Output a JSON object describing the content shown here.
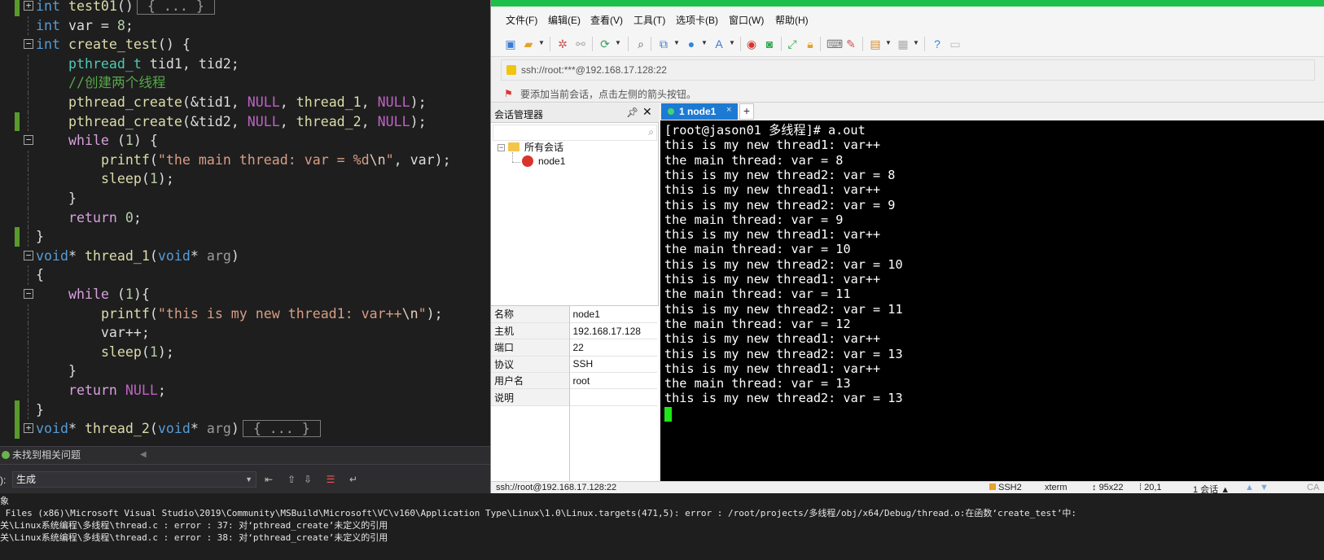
{
  "editor": {
    "lines": [
      {
        "tokens": [
          [
            "kw",
            "int "
          ],
          [
            "fn",
            "test01"
          ],
          [
            "",
            "()"
          ]
        ],
        "collapsed": "{ ... }",
        "fold": "+",
        "mark": true
      },
      {
        "tokens": [
          [
            "kw",
            "int "
          ],
          [
            "",
            "var = "
          ],
          [
            "num",
            "8"
          ],
          [
            "",
            ";"
          ]
        ],
        "fold": "",
        "mark": false
      },
      {
        "tokens": [
          [
            "kw",
            "int "
          ],
          [
            "fn",
            "create_test"
          ],
          [
            "",
            "() {"
          ]
        ],
        "fold": "-",
        "mark": false
      },
      {
        "tokens": [
          [
            "",
            "    "
          ],
          [
            "ty",
            "pthread_t"
          ],
          [
            "",
            " tid1, tid2;"
          ]
        ],
        "fold": "",
        "mark": false
      },
      {
        "tokens": [
          [
            "",
            "    "
          ],
          [
            "cm",
            "//创建两个线程"
          ]
        ],
        "fold": "",
        "mark": false
      },
      {
        "tokens": [
          [
            "",
            "    "
          ],
          [
            "fn",
            "pthread_create"
          ],
          [
            "",
            "(&tid1, "
          ],
          [
            "mac",
            "NULL"
          ],
          [
            "",
            ", "
          ],
          [
            "fn",
            "thread_1"
          ],
          [
            "",
            ", "
          ],
          [
            "mac",
            "NULL"
          ],
          [
            "",
            ");"
          ]
        ],
        "fold": "",
        "mark": false
      },
      {
        "tokens": [
          [
            "",
            "    "
          ],
          [
            "fn",
            "pthread_create"
          ],
          [
            "",
            "(&tid2, "
          ],
          [
            "mac",
            "NULL"
          ],
          [
            "",
            ", "
          ],
          [
            "fn",
            "thread_2"
          ],
          [
            "",
            ", "
          ],
          [
            "mac",
            "NULL"
          ],
          [
            "",
            ");"
          ]
        ],
        "fold": "",
        "mark": true
      },
      {
        "tokens": [
          [
            "",
            "    "
          ],
          [
            "ctl",
            "while"
          ],
          [
            "",
            " ("
          ],
          [
            "num",
            "1"
          ],
          [
            "",
            ") {"
          ]
        ],
        "fold": "-",
        "mark": false
      },
      {
        "tokens": [
          [
            "",
            "        "
          ],
          [
            "fn",
            "printf"
          ],
          [
            "",
            "("
          ],
          [
            "str",
            "\"the main thread: var = %d"
          ],
          [
            "esc",
            "\\n"
          ],
          [
            "str",
            "\""
          ],
          [
            "",
            ", var);"
          ]
        ],
        "fold": "",
        "mark": false
      },
      {
        "tokens": [
          [
            "",
            "        "
          ],
          [
            "fn",
            "sleep"
          ],
          [
            "",
            "("
          ],
          [
            "num",
            "1"
          ],
          [
            "",
            ");"
          ]
        ],
        "fold": "",
        "mark": false
      },
      {
        "tokens": [
          [
            "",
            "    }"
          ]
        ],
        "fold": "",
        "mark": false
      },
      {
        "tokens": [
          [
            "",
            "    "
          ],
          [
            "ctl",
            "return"
          ],
          [
            "",
            " "
          ],
          [
            "num",
            "0"
          ],
          [
            "",
            ";"
          ]
        ],
        "fold": "",
        "mark": false
      },
      {
        "tokens": [
          [
            "",
            "}"
          ]
        ],
        "fold": "",
        "mark": true
      },
      {
        "tokens": [
          [
            "kw",
            "void"
          ],
          [
            "",
            "* "
          ],
          [
            "fn",
            "thread_1"
          ],
          [
            "",
            "("
          ],
          [
            "kw",
            "void"
          ],
          [
            "",
            "* "
          ],
          [
            "param",
            "arg"
          ],
          [
            "",
            ")"
          ]
        ],
        "fold": "-",
        "mark": false
      },
      {
        "tokens": [
          [
            "",
            "{"
          ]
        ],
        "fold": "",
        "mark": false
      },
      {
        "tokens": [
          [
            "",
            "    "
          ],
          [
            "ctl",
            "while"
          ],
          [
            "",
            " ("
          ],
          [
            "num",
            "1"
          ],
          [
            "",
            "){"
          ]
        ],
        "fold": "-",
        "mark": false
      },
      {
        "tokens": [
          [
            "",
            "        "
          ],
          [
            "fn",
            "printf"
          ],
          [
            "",
            "("
          ],
          [
            "str",
            "\"this is my new thread1: var++"
          ],
          [
            "esc",
            "\\n"
          ],
          [
            "str",
            "\""
          ],
          [
            "",
            ");"
          ]
        ],
        "fold": "",
        "mark": false
      },
      {
        "tokens": [
          [
            "",
            "        var++;"
          ]
        ],
        "fold": "",
        "mark": false
      },
      {
        "tokens": [
          [
            "",
            "        "
          ],
          [
            "fn",
            "sleep"
          ],
          [
            "",
            "("
          ],
          [
            "num",
            "1"
          ],
          [
            "",
            ");"
          ]
        ],
        "fold": "",
        "mark": false
      },
      {
        "tokens": [
          [
            "",
            "    }"
          ]
        ],
        "fold": "",
        "mark": false
      },
      {
        "tokens": [
          [
            "",
            "    "
          ],
          [
            "ctl",
            "return"
          ],
          [
            "",
            " "
          ],
          [
            "mac",
            "NULL"
          ],
          [
            "",
            ";"
          ]
        ],
        "fold": "",
        "mark": false
      },
      {
        "tokens": [
          [
            "",
            "}"
          ]
        ],
        "fold": "",
        "mark": true
      },
      {
        "tokens": [
          [
            "kw",
            "void"
          ],
          [
            "",
            "* "
          ],
          [
            "fn",
            "thread_2"
          ],
          [
            "",
            "("
          ],
          [
            "kw",
            "void"
          ],
          [
            "",
            "* "
          ],
          [
            "param",
            "arg"
          ],
          [
            "",
            ")"
          ]
        ],
        "collapsed": "{ ... }",
        "fold": "+",
        "mark": true
      }
    ]
  },
  "vs_status": {
    "message": "未找到相关问题"
  },
  "vs_output": {
    "source_label": "):",
    "source_value": "生成",
    "lines": [
      "象",
      " Files (x86)\\Microsoft Visual Studio\\2019\\Community\\MSBuild\\Microsoft\\VC\\v160\\Application Type\\Linux\\1.0\\Linux.targets(471,5): error : /root/projects/多线程/obj/x64/Debug/thread.o:在函数‘create_test’中:",
      "关\\Linux系统编程\\多线程\\thread.c : error : 37: 对‘pthread_create’未定义的引用",
      "关\\Linux系统编程\\多线程\\thread.c : error : 38: 对‘pthread_create’未定义的引用"
    ]
  },
  "xshell": {
    "colors": {
      "title_strip": "#1fbf4b",
      "tab_active": "#1d7ad3",
      "cursor": "#1ee617"
    },
    "menu": [
      "文件(F)",
      "编辑(E)",
      "查看(V)",
      "工具(T)",
      "选项卡(B)",
      "窗口(W)",
      "帮助(H)"
    ],
    "address": "ssh://root:***@192.168.17.128:22",
    "hint": "要添加当前会话，点击左侧的箭头按钮。",
    "session_manager": {
      "title": "会话管理器",
      "tree": {
        "folder": "所有会话",
        "session": "node1"
      },
      "properties": [
        {
          "key": "名称",
          "value": "node1"
        },
        {
          "key": "主机",
          "value": "192.168.17.128"
        },
        {
          "key": "端口",
          "value": "22"
        },
        {
          "key": "协议",
          "value": "SSH"
        },
        {
          "key": "用户名",
          "value": "root"
        },
        {
          "key": "说明",
          "value": ""
        }
      ]
    },
    "tab": {
      "label": "1 node1",
      "close": "×",
      "add": "+"
    },
    "terminal_lines": [
      "[root@jason01 多线程]# a.out",
      "this is my new thread1: var++",
      "the main thread: var = 8",
      "this is my new thread2: var = 8",
      "this is my new thread1: var++",
      "this is my new thread2: var = 9",
      "the main thread: var = 9",
      "this is my new thread1: var++",
      "the main thread: var = 10",
      "this is my new thread2: var = 10",
      "this is my new thread1: var++",
      "the main thread: var = 11",
      "this is my new thread2: var = 11",
      "the main thread: var = 12",
      "this is my new thread1: var++",
      "this is my new thread2: var = 13",
      "this is my new thread1: var++",
      "the main thread: var = 13",
      "this is my new thread2: var = 13"
    ],
    "status": {
      "connection": "ssh://root@192.168.17.128:22",
      "protocol": "SSH2",
      "terminal": "xterm",
      "size": "95x22",
      "cursor_pos": "20,1",
      "sessions": "1 会话",
      "caps": "CA"
    }
  }
}
